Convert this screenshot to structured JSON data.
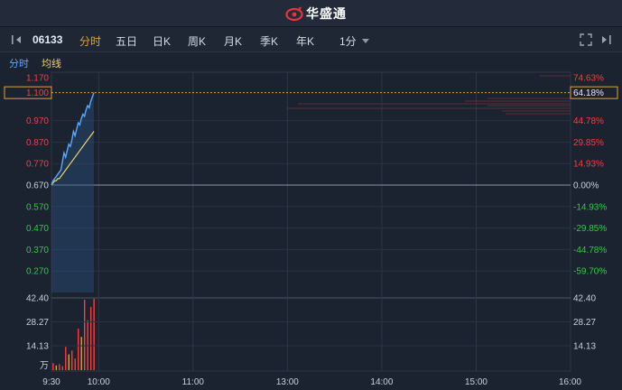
{
  "app": {
    "brand": "华盛通"
  },
  "toolbar": {
    "code": "06133",
    "tabs": [
      "分时",
      "五日",
      "日K",
      "周K",
      "月K",
      "季K",
      "年K"
    ],
    "active_tab": "分时",
    "interval": "1分"
  },
  "subtabs": {
    "left": "分时",
    "right": "均线"
  },
  "price_axis": {
    "top_label": "1.170",
    "current_price": "1.100",
    "ticks": [
      "0.970",
      "0.870",
      "0.770",
      "0.670",
      "0.570",
      "0.470",
      "0.370",
      "0.270"
    ],
    "prev_close": 0.67
  },
  "pct_axis": {
    "top_label": "74.63%",
    "current_pct": "64.18%",
    "ticks": [
      "44.78%",
      "29.85%",
      "14.93%",
      "0.00%",
      "-14.93%",
      "-29.85%",
      "-44.78%",
      "-59.70%"
    ]
  },
  "volume_axis": {
    "ticks": [
      "42.40",
      "28.27",
      "14.13"
    ],
    "unit": "万"
  },
  "time_axis": [
    "9:30",
    "10:00",
    "11:00",
    "13:00",
    "14:00",
    "15:00",
    "16:00"
  ],
  "colors": {
    "up": "#ff3b3b",
    "down": "#2ecc40",
    "price_line": "#5aa9ff",
    "avg_line": "#f0d36a",
    "accent": "#e0a23a"
  },
  "chart_data": {
    "type": "line",
    "x_unit": "minutes since 9:30",
    "series": [
      {
        "name": "分时",
        "x": [
          0,
          1,
          2,
          3,
          4,
          5,
          6,
          7,
          8,
          9,
          10,
          11,
          12,
          13,
          14,
          15,
          16,
          17,
          18,
          19,
          20,
          21,
          22,
          23,
          24,
          25,
          26,
          27
        ],
        "values": [
          0.67,
          0.69,
          0.7,
          0.71,
          0.72,
          0.73,
          0.74,
          0.78,
          0.82,
          0.8,
          0.83,
          0.86,
          0.85,
          0.88,
          0.92,
          0.9,
          0.93,
          0.96,
          0.95,
          0.98,
          1.0,
          0.99,
          1.02,
          1.04,
          1.03,
          1.06,
          1.08,
          1.1
        ]
      },
      {
        "name": "均线",
        "x": [
          0,
          1,
          2,
          3,
          4,
          5,
          6,
          7,
          8,
          9,
          10,
          11,
          12,
          13,
          14,
          15,
          16,
          17,
          18,
          19,
          20,
          21,
          22,
          23,
          24,
          25,
          26,
          27
        ],
        "values": [
          0.67,
          0.68,
          0.69,
          0.69,
          0.7,
          0.7,
          0.71,
          0.72,
          0.73,
          0.74,
          0.75,
          0.76,
          0.77,
          0.78,
          0.79,
          0.8,
          0.81,
          0.82,
          0.83,
          0.84,
          0.85,
          0.86,
          0.87,
          0.88,
          0.89,
          0.9,
          0.91,
          0.92
        ]
      }
    ],
    "volume": {
      "x": [
        1,
        3,
        5,
        7,
        9,
        11,
        13,
        15,
        17,
        19,
        21,
        23,
        25,
        27
      ],
      "values": [
        4.2,
        2.8,
        3.6,
        2.4,
        14.0,
        9.5,
        11.8,
        7.0,
        25.0,
        20.0,
        42.4,
        30.0,
        38.0,
        44.0
      ],
      "up": [
        true,
        false,
        true,
        true,
        true,
        false,
        true,
        true,
        true,
        false,
        true,
        true,
        true,
        true
      ]
    },
    "ylim": [
      0.17,
      1.17
    ],
    "volume_ylim": [
      0,
      42.4
    ]
  }
}
